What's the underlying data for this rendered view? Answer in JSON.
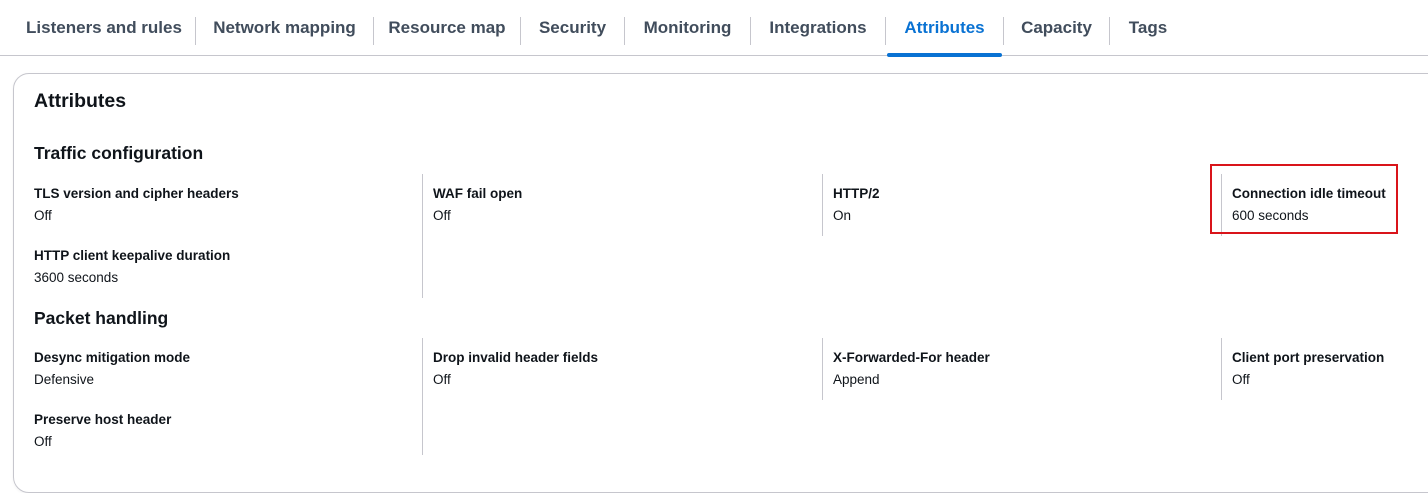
{
  "tabs": [
    {
      "label": "Listeners and rules",
      "active": false
    },
    {
      "label": "Network mapping",
      "active": false
    },
    {
      "label": "Resource map",
      "active": false
    },
    {
      "label": "Security",
      "active": false
    },
    {
      "label": "Monitoring",
      "active": false
    },
    {
      "label": "Integrations",
      "active": false
    },
    {
      "label": "Attributes",
      "active": true
    },
    {
      "label": "Capacity",
      "active": false
    },
    {
      "label": "Tags",
      "active": false
    }
  ],
  "panel": {
    "title": "Attributes",
    "traffic": {
      "title": "Traffic configuration",
      "items": [
        {
          "label": "TLS version and cipher headers",
          "value": "Off"
        },
        {
          "label": "WAF fail open",
          "value": "Off"
        },
        {
          "label": "HTTP/2",
          "value": "On"
        },
        {
          "label": "Connection idle timeout",
          "value": "600 seconds"
        },
        {
          "label": "HTTP client keepalive duration",
          "value": "3600 seconds"
        }
      ]
    },
    "packet": {
      "title": "Packet handling",
      "items": [
        {
          "label": "Desync mitigation mode",
          "value": "Defensive"
        },
        {
          "label": "Drop invalid header fields",
          "value": "Off"
        },
        {
          "label": "X-Forwarded-For header",
          "value": "Append"
        },
        {
          "label": "Client port preservation",
          "value": "Off"
        },
        {
          "label": "Preserve host header",
          "value": "Off"
        }
      ]
    }
  },
  "colors": {
    "active_tab": "#0972d3",
    "highlight_box": "#d9141a",
    "divider": "#c6c6cd"
  }
}
